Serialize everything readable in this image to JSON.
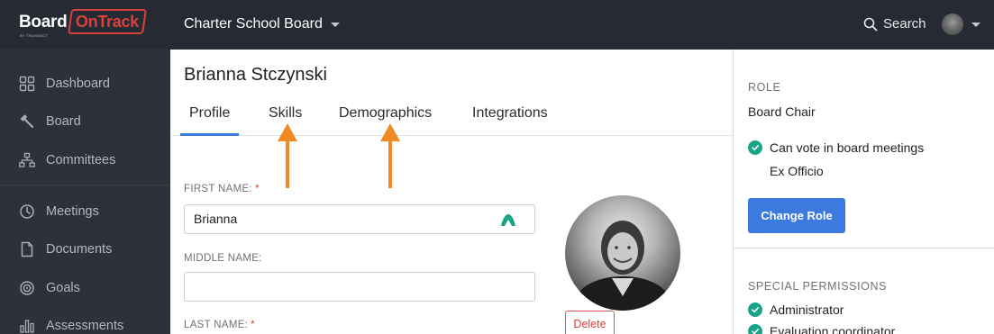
{
  "brand": {
    "name_part1": "Board",
    "name_part2": "OnTrack",
    "sub": "BY TRANSACT"
  },
  "header": {
    "org_name": "Charter School Board",
    "search_label": "Search"
  },
  "sidebar": {
    "items": [
      {
        "label": "Dashboard",
        "icon": "grid-icon"
      },
      {
        "label": "Board",
        "icon": "gavel-icon"
      },
      {
        "label": "Committees",
        "icon": "sitemap-icon"
      },
      {
        "label": "Meetings",
        "icon": "clock-icon"
      },
      {
        "label": "Documents",
        "icon": "file-icon"
      },
      {
        "label": "Goals",
        "icon": "target-icon"
      },
      {
        "label": "Assessments",
        "icon": "bar-chart-icon"
      }
    ]
  },
  "profile": {
    "name": "Brianna Stczynski",
    "tabs": [
      "Profile",
      "Skills",
      "Demographics",
      "Integrations"
    ],
    "active_tab": "Profile",
    "fields": {
      "first_name_label": "FIRST NAME:",
      "first_name_value": "Brianna",
      "middle_name_label": "MIDDLE NAME:",
      "middle_name_value": "",
      "last_name_label": "LAST NAME:",
      "required_mark": "*"
    },
    "delete_label": "Delete"
  },
  "annotations": {
    "arrow_color": "#f08a24"
  },
  "role_panel": {
    "role_title": "ROLE",
    "role_value": "Board Chair",
    "can_vote": "Can vote in board meetings",
    "ex_officio": "Ex Officio",
    "change_role_label": "Change Role",
    "special_permissions_title": "SPECIAL PERMISSIONS",
    "permissions": [
      "Administrator",
      "Evaluation coordinator"
    ]
  },
  "colors": {
    "topbar": "#262a33",
    "sidebar": "#2d313a",
    "accent": "#3d7ae0",
    "brand_red": "#d9413d",
    "check_green": "#19a48a"
  }
}
